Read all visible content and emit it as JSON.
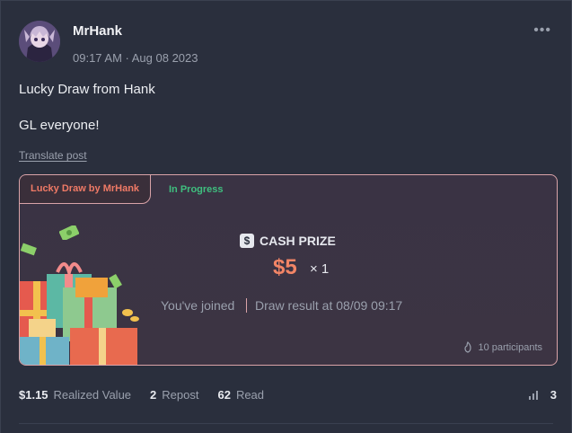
{
  "post": {
    "author": "MrHank",
    "timestamp": "09:17 AM · Aug 08 2023",
    "more_icon": "ellipsis-icon",
    "lines": [
      "Lucky Draw from Hank",
      "GL everyone!"
    ],
    "translate_label": "Translate post"
  },
  "draw": {
    "tag": "Lucky Draw by MrHank",
    "status": "In Progress",
    "prize_label": "CASH PRIZE",
    "prize_icon": "$",
    "amount": "$5",
    "quantity": "× 1",
    "joined": "You've joined",
    "result": "Draw result at 08/09 09:17",
    "participants": "10 participants"
  },
  "stats": {
    "value": "$1.15",
    "value_label": "Realized Value",
    "reposts": "2",
    "reposts_label": "Repost",
    "reads": "62",
    "reads_label": "Read",
    "bars_count": "3"
  },
  "colors": {
    "accent": "#f28566",
    "status": "#3fbf7f",
    "border": "#d9a3a8"
  }
}
